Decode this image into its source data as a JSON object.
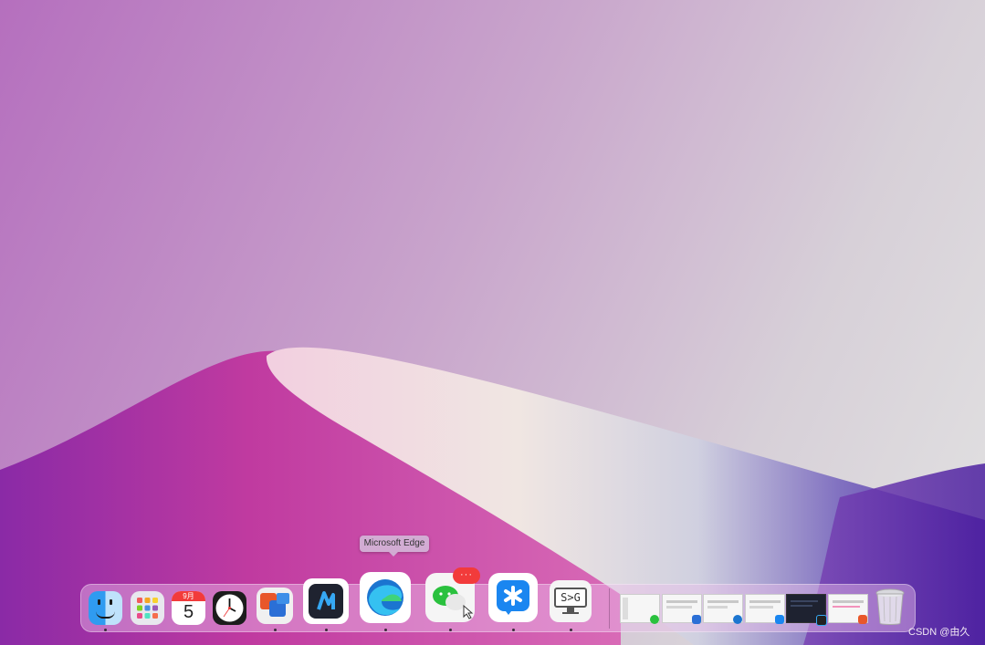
{
  "tooltip": {
    "text": "Microsoft Edge"
  },
  "dock": {
    "apps": [
      {
        "id": "finder",
        "icon": "finder-icon",
        "running": true
      },
      {
        "id": "launchpad",
        "icon": "launchpad-icon",
        "running": false
      },
      {
        "id": "calendar",
        "icon": "calendar-icon",
        "month": "9月",
        "day": "5",
        "running": false
      },
      {
        "id": "clock",
        "icon": "clock-icon",
        "running": false
      },
      {
        "id": "office",
        "icon": "office-tools-icon",
        "running": true
      },
      {
        "id": "app-dark",
        "icon": "dark-app-icon",
        "running": true
      },
      {
        "id": "edge",
        "icon": "edge-icon",
        "running": true
      },
      {
        "id": "wechat",
        "icon": "wechat-icon",
        "badge": "···",
        "running": true
      },
      {
        "id": "dingtalk",
        "icon": "dingtalk-icon",
        "running": true
      },
      {
        "id": "s-g",
        "icon": "terminal-icon",
        "label": "S>G",
        "running": true
      }
    ],
    "minimized_windows": 6
  },
  "watermark": "CSDN @由久",
  "colors": {
    "accent_red": "#f23b3b",
    "edge_blue": "#1b75d0",
    "wechat_green": "#2ac13e"
  }
}
